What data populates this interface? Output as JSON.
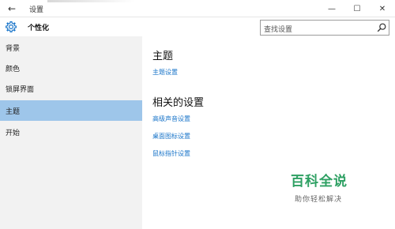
{
  "window": {
    "title": "设置",
    "back_icon": "←",
    "minimize": "—",
    "maximize": "☐",
    "close": "✕"
  },
  "header": {
    "title": "个性化",
    "search_placeholder": "查找设置"
  },
  "sidebar": {
    "items": [
      {
        "label": "背景",
        "selected": false
      },
      {
        "label": "颜色",
        "selected": false
      },
      {
        "label": "锁屏界面",
        "selected": false
      },
      {
        "label": "主题",
        "selected": true
      },
      {
        "label": "开始",
        "selected": false
      }
    ]
  },
  "main": {
    "section1_title": "主题",
    "theme_settings_link": "主题设置",
    "section2_title": "相关的设置",
    "related_links": [
      "高级声音设置",
      "桌面图标设置",
      "鼠标指针设置"
    ]
  },
  "watermark": {
    "brand": "百科全说",
    "tagline": "助你轻松解决"
  },
  "colors": {
    "accent": "#1a75c9",
    "selected": "#9ec6ea",
    "sidebar_bg": "#f2f2f2",
    "watermark": "#2ea063"
  }
}
